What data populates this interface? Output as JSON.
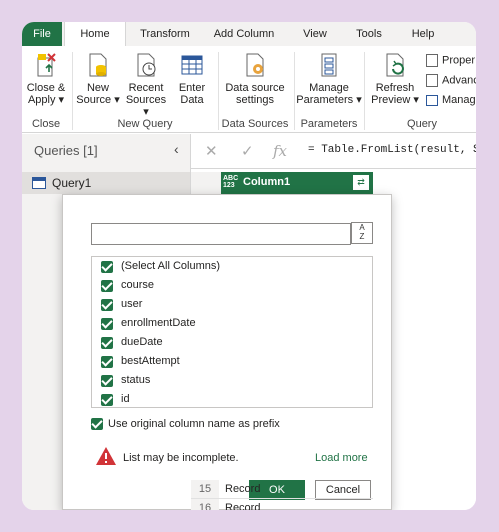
{
  "tabs": [
    "File",
    "Home",
    "Transform",
    "Add Column",
    "View",
    "Tools",
    "Help"
  ],
  "ribbon": {
    "close_apply": [
      "Close &",
      "Apply ▾"
    ],
    "new_source": [
      "New",
      "Source ▾"
    ],
    "recent_sources": [
      "Recent",
      "Sources ▾"
    ],
    "enter_data": [
      "Enter",
      "Data"
    ],
    "data_source_settings": [
      "Data source",
      "settings"
    ],
    "manage_parameters": [
      "Manage",
      "Parameters ▾"
    ],
    "refresh_preview": [
      "Refresh",
      "Preview ▾"
    ],
    "properties": "Proper",
    "advanced": "Advanc",
    "manage": "Manag",
    "groups": [
      "Close",
      "New Query",
      "Data Sources",
      "Parameters",
      "Query"
    ]
  },
  "queries": {
    "header": "Queries [1]",
    "collapse": "‹",
    "item": "Query1"
  },
  "formula": {
    "cancel": "✕",
    "commit": "✓",
    "fx": "fx",
    "text": "= Table.FromList(result, Sp"
  },
  "column": {
    "type": "ABC\n123",
    "name": "Column1",
    "expand": "⇄"
  },
  "rows": [
    {
      "n": "15",
      "v": "Record"
    },
    {
      "n": "16",
      "v": "Record"
    }
  ],
  "dialog": {
    "search_value": "",
    "sort": "A\nZ",
    "items": [
      "(Select All Columns)",
      "course",
      "user",
      "enrollmentDate",
      "dueDate",
      "bestAttempt",
      "status",
      "id"
    ],
    "prefix_label": "Use original column name as prefix",
    "warning": "List may be incomplete.",
    "load_more": "Load more",
    "ok": "OK",
    "cancel": "Cancel"
  },
  "colors": {
    "accent": "#217346",
    "background": "#e4d3ea"
  }
}
